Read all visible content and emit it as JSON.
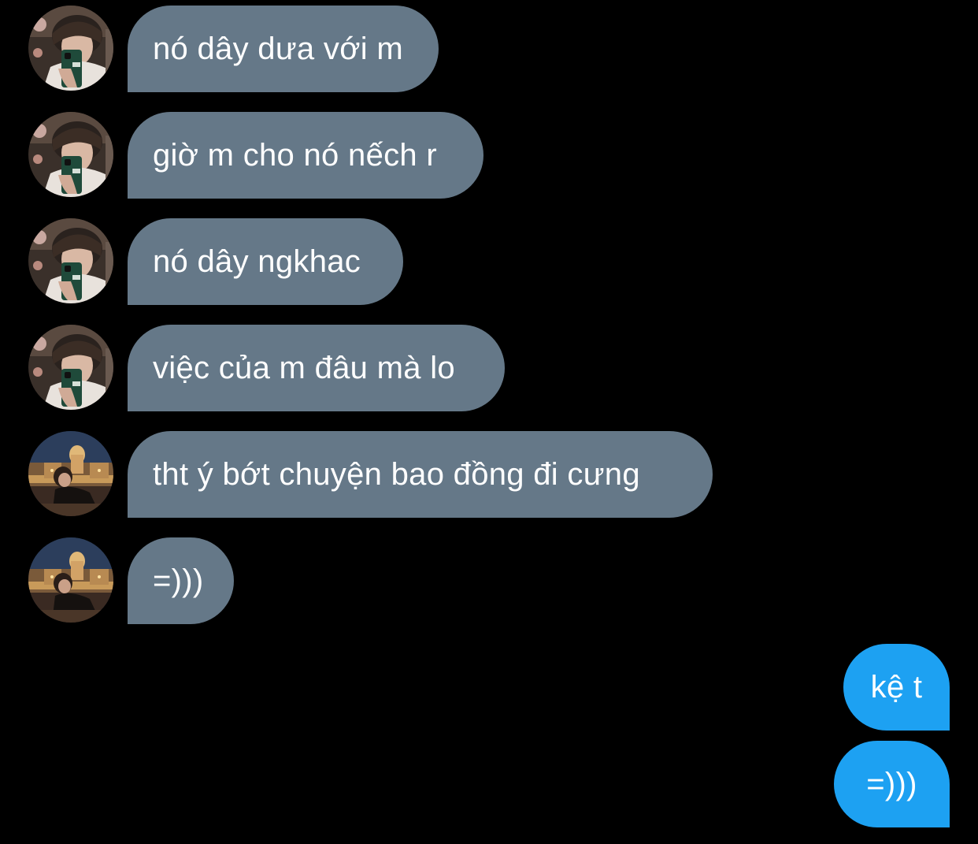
{
  "conversation": {
    "messages": [
      {
        "direction": "incoming",
        "sender_avatar": "mirror-selfie-avatar",
        "text": "nó dây dưa với m"
      },
      {
        "direction": "incoming",
        "sender_avatar": "mirror-selfie-avatar",
        "text": "giờ m cho nó nếch r"
      },
      {
        "direction": "incoming",
        "sender_avatar": "mirror-selfie-avatar",
        "text": "nó dây ngkhac"
      },
      {
        "direction": "incoming",
        "sender_avatar": "mirror-selfie-avatar",
        "text": "việc của m đâu mà lo"
      },
      {
        "direction": "incoming",
        "sender_avatar": "night-city-avatar",
        "text": "tht ý bớt chuyện bao đồng đi cưng"
      },
      {
        "direction": "incoming",
        "sender_avatar": "night-city-avatar",
        "text": "=)))"
      },
      {
        "direction": "outgoing",
        "text": "kệ t"
      },
      {
        "direction": "outgoing",
        "text": "=)))"
      }
    ]
  },
  "colors": {
    "background": "#000000",
    "incoming_bubble": "#657888",
    "outgoing_bubble": "#1da1f2",
    "text": "#ffffff"
  }
}
